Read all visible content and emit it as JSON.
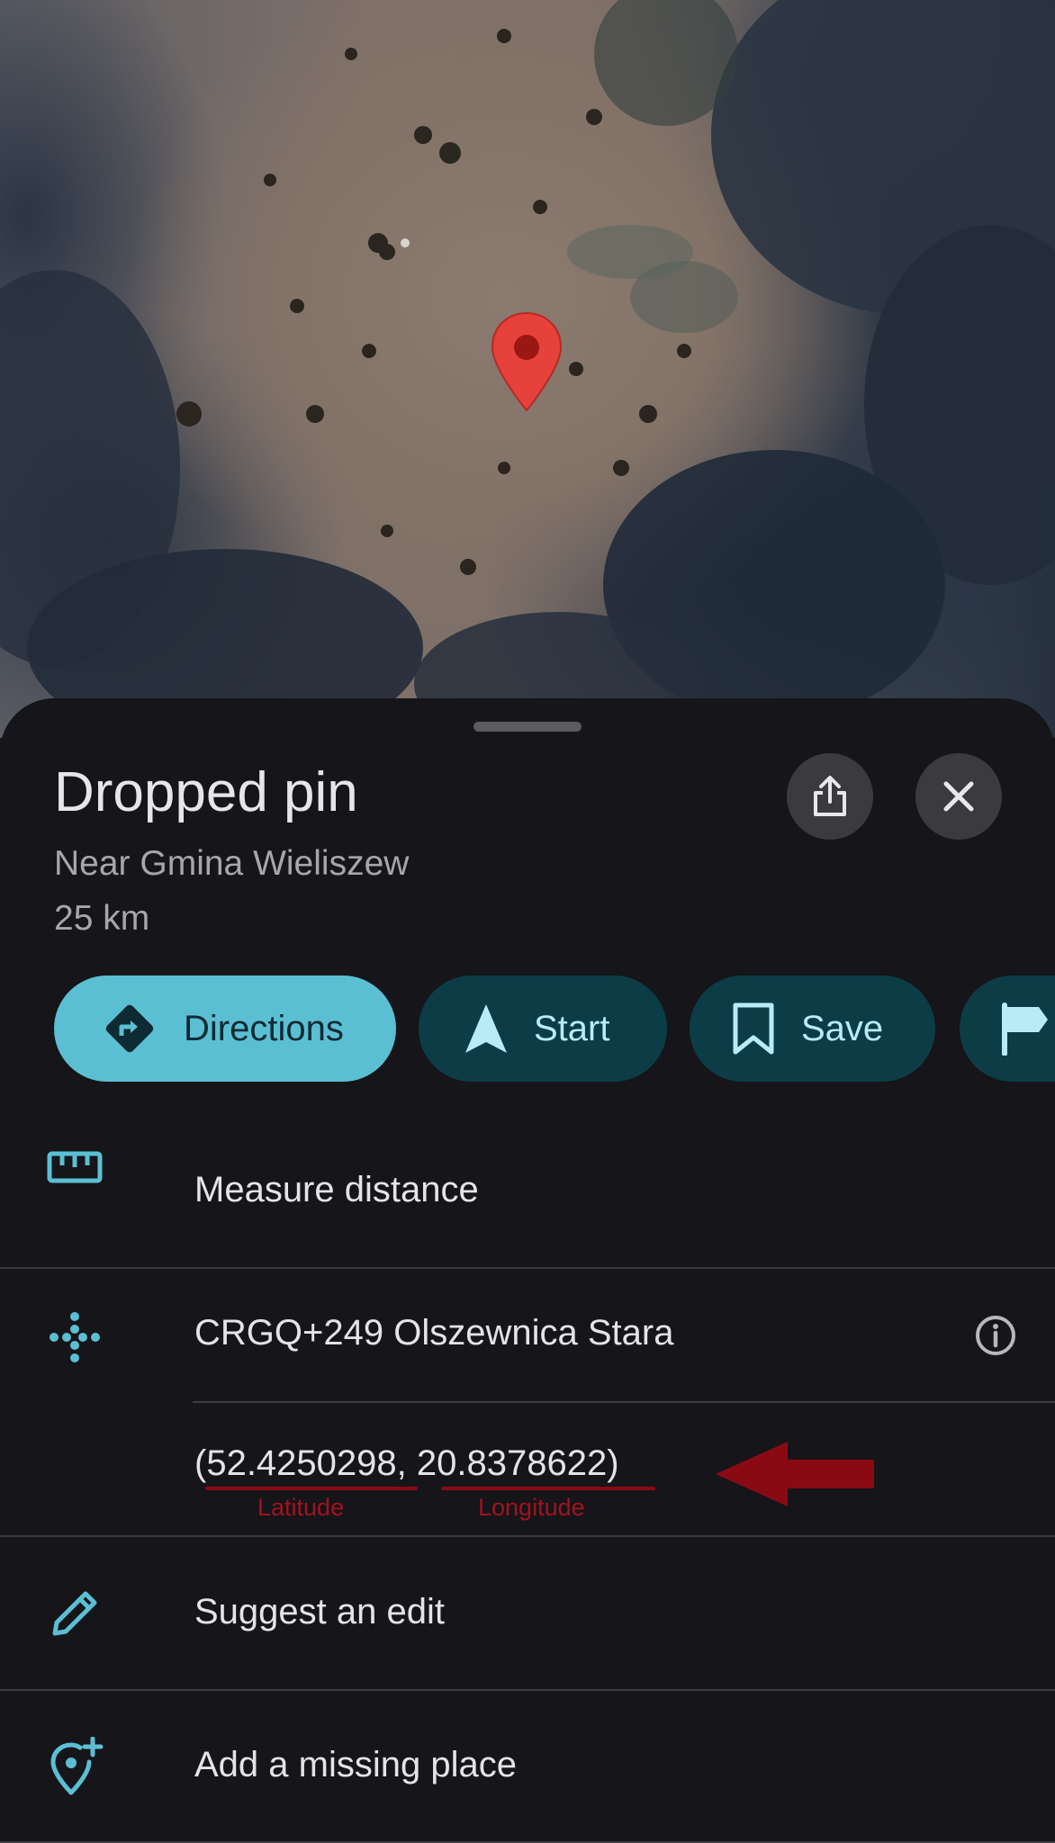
{
  "map": {
    "pin_icon": "map-pin-icon",
    "pin_color": "#e6413a"
  },
  "place": {
    "title": "Dropped pin",
    "subtitle": "Near Gmina Wieliszew",
    "distance": "25 km"
  },
  "header_actions": {
    "share_icon": "share-icon",
    "close_icon": "close-icon"
  },
  "chips": {
    "directions": "Directions",
    "start": "Start",
    "save": "Save",
    "label_icon": "flag-icon"
  },
  "list": {
    "measure_distance": "Measure distance",
    "plus_code": "CRGQ+249 Olszewnica Stara",
    "coords": {
      "open": "(",
      "latitude": "52.4250298",
      "separator": ", ",
      "longitude": "20.8378622",
      "close": ")"
    },
    "suggest_edit": "Suggest an edit",
    "add_missing_place": "Add a missing place"
  },
  "annotations": {
    "latitude_label": "Latitude",
    "longitude_label": "Longitude",
    "color": "#8a0a14"
  },
  "colors": {
    "accent": "#5bbfd3",
    "chip_dark": "#0c3d47",
    "sheet_bg": "#15151a"
  }
}
